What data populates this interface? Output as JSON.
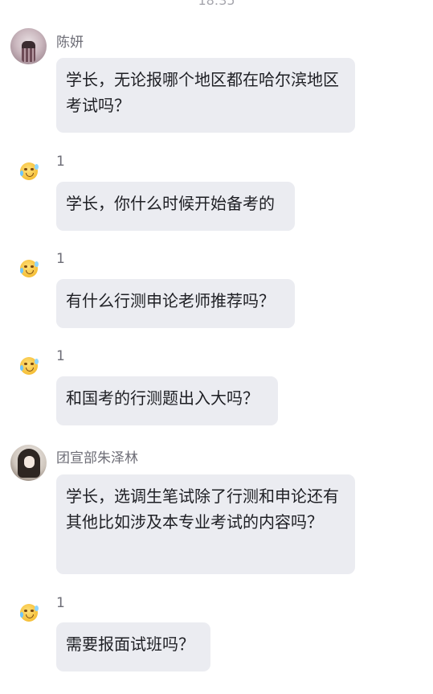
{
  "time": "18:35",
  "messages": [
    {
      "sender": "陈妍",
      "avatar_icon": "girl-photo-avatar",
      "text": "学长，无论报哪个地区都在哈尔滨地区考试吗？"
    },
    {
      "sender": "1",
      "avatar_icon": "crying-smile-emoji-avatar",
      "text": "学长，你什么时候开始备考的"
    },
    {
      "sender": "1",
      "avatar_icon": "crying-smile-emoji-avatar",
      "text": "有什么行测申论老师推荐吗？"
    },
    {
      "sender": "1",
      "avatar_icon": "crying-smile-emoji-avatar",
      "text": "和国考的行测题出入大吗？"
    },
    {
      "sender": "团宣部朱泽林",
      "avatar_icon": "anime-girl-photo-avatar",
      "text": "学长，选调生笔试除了行测和申论还有其他比如涉及本专业考试的内容吗？"
    },
    {
      "sender": "1",
      "avatar_icon": "crying-smile-emoji-avatar",
      "text": "需要报面试班吗？"
    }
  ]
}
